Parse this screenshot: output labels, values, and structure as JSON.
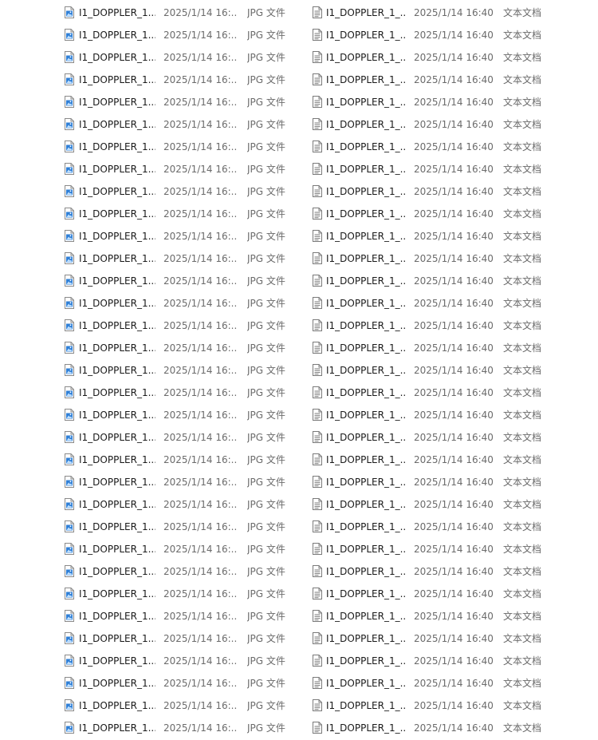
{
  "left_files": [
    {
      "name": "I1_DOPPLER_1...",
      "modified": "2025/1/14 16:...",
      "type": "JPG 文件"
    },
    {
      "name": "I1_DOPPLER_1...",
      "modified": "2025/1/14 16:...",
      "type": "JPG 文件"
    },
    {
      "name": "I1_DOPPLER_1...",
      "modified": "2025/1/14 16:...",
      "type": "JPG 文件"
    },
    {
      "name": "I1_DOPPLER_1...",
      "modified": "2025/1/14 16:...",
      "type": "JPG 文件"
    },
    {
      "name": "I1_DOPPLER_1...",
      "modified": "2025/1/14 16:...",
      "type": "JPG 文件"
    },
    {
      "name": "I1_DOPPLER_1...",
      "modified": "2025/1/14 16:...",
      "type": "JPG 文件"
    },
    {
      "name": "I1_DOPPLER_1...",
      "modified": "2025/1/14 16:...",
      "type": "JPG 文件"
    },
    {
      "name": "I1_DOPPLER_1...",
      "modified": "2025/1/14 16:...",
      "type": "JPG 文件"
    },
    {
      "name": "I1_DOPPLER_1...",
      "modified": "2025/1/14 16:...",
      "type": "JPG 文件"
    },
    {
      "name": "I1_DOPPLER_1...",
      "modified": "2025/1/14 16:...",
      "type": "JPG 文件"
    },
    {
      "name": "I1_DOPPLER_1...",
      "modified": "2025/1/14 16:...",
      "type": "JPG 文件"
    },
    {
      "name": "I1_DOPPLER_1...",
      "modified": "2025/1/14 16:...",
      "type": "JPG 文件"
    },
    {
      "name": "I1_DOPPLER_1...",
      "modified": "2025/1/14 16:...",
      "type": "JPG 文件"
    },
    {
      "name": "I1_DOPPLER_1...",
      "modified": "2025/1/14 16:...",
      "type": "JPG 文件"
    },
    {
      "name": "I1_DOPPLER_1...",
      "modified": "2025/1/14 16:...",
      "type": "JPG 文件"
    },
    {
      "name": "I1_DOPPLER_1...",
      "modified": "2025/1/14 16:...",
      "type": "JPG 文件"
    },
    {
      "name": "I1_DOPPLER_1...",
      "modified": "2025/1/14 16:...",
      "type": "JPG 文件"
    },
    {
      "name": "I1_DOPPLER_1...",
      "modified": "2025/1/14 16:...",
      "type": "JPG 文件"
    },
    {
      "name": "I1_DOPPLER_1...",
      "modified": "2025/1/14 16:...",
      "type": "JPG 文件"
    },
    {
      "name": "I1_DOPPLER_1...",
      "modified": "2025/1/14 16:...",
      "type": "JPG 文件"
    },
    {
      "name": "I1_DOPPLER_1...",
      "modified": "2025/1/14 16:...",
      "type": "JPG 文件"
    },
    {
      "name": "I1_DOPPLER_1...",
      "modified": "2025/1/14 16:...",
      "type": "JPG 文件"
    },
    {
      "name": "I1_DOPPLER_1...",
      "modified": "2025/1/14 16:...",
      "type": "JPG 文件"
    },
    {
      "name": "I1_DOPPLER_1...",
      "modified": "2025/1/14 16:...",
      "type": "JPG 文件"
    },
    {
      "name": "I1_DOPPLER_1...",
      "modified": "2025/1/14 16:...",
      "type": "JPG 文件"
    },
    {
      "name": "I1_DOPPLER_1...",
      "modified": "2025/1/14 16:...",
      "type": "JPG 文件"
    },
    {
      "name": "I1_DOPPLER_1...",
      "modified": "2025/1/14 16:...",
      "type": "JPG 文件"
    },
    {
      "name": "I1_DOPPLER_1...",
      "modified": "2025/1/14 16:...",
      "type": "JPG 文件"
    },
    {
      "name": "I1_DOPPLER_1...",
      "modified": "2025/1/14 16:...",
      "type": "JPG 文件"
    },
    {
      "name": "I1_DOPPLER_1...",
      "modified": "2025/1/14 16:...",
      "type": "JPG 文件"
    },
    {
      "name": "I1_DOPPLER_1...",
      "modified": "2025/1/14 16:...",
      "type": "JPG 文件"
    },
    {
      "name": "I1_DOPPLER_1...",
      "modified": "2025/1/14 16:...",
      "type": "JPG 文件"
    },
    {
      "name": "I1_DOPPLER_1...",
      "modified": "2025/1/14 16:...",
      "type": "JPG 文件"
    }
  ],
  "right_files": [
    {
      "name": "I1_DOPPLER_1_...",
      "modified": "2025/1/14 16:40",
      "type": "文本文档"
    },
    {
      "name": "I1_DOPPLER_1_...",
      "modified": "2025/1/14 16:40",
      "type": "文本文档"
    },
    {
      "name": "I1_DOPPLER_1_...",
      "modified": "2025/1/14 16:40",
      "type": "文本文档"
    },
    {
      "name": "I1_DOPPLER_1_...",
      "modified": "2025/1/14 16:40",
      "type": "文本文档"
    },
    {
      "name": "I1_DOPPLER_1_...",
      "modified": "2025/1/14 16:40",
      "type": "文本文档"
    },
    {
      "name": "I1_DOPPLER_1_...",
      "modified": "2025/1/14 16:40",
      "type": "文本文档"
    },
    {
      "name": "I1_DOPPLER_1_...",
      "modified": "2025/1/14 16:40",
      "type": "文本文档"
    },
    {
      "name": "I1_DOPPLER_1_...",
      "modified": "2025/1/14 16:40",
      "type": "文本文档"
    },
    {
      "name": "I1_DOPPLER_1_...",
      "modified": "2025/1/14 16:40",
      "type": "文本文档"
    },
    {
      "name": "I1_DOPPLER_1_...",
      "modified": "2025/1/14 16:40",
      "type": "文本文档"
    },
    {
      "name": "I1_DOPPLER_1_...",
      "modified": "2025/1/14 16:40",
      "type": "文本文档"
    },
    {
      "name": "I1_DOPPLER_1_...",
      "modified": "2025/1/14 16:40",
      "type": "文本文档"
    },
    {
      "name": "I1_DOPPLER_1_...",
      "modified": "2025/1/14 16:40",
      "type": "文本文档"
    },
    {
      "name": "I1_DOPPLER_1_...",
      "modified": "2025/1/14 16:40",
      "type": "文本文档"
    },
    {
      "name": "I1_DOPPLER_1_...",
      "modified": "2025/1/14 16:40",
      "type": "文本文档"
    },
    {
      "name": "I1_DOPPLER_1_...",
      "modified": "2025/1/14 16:40",
      "type": "文本文档"
    },
    {
      "name": "I1_DOPPLER_1_...",
      "modified": "2025/1/14 16:40",
      "type": "文本文档"
    },
    {
      "name": "I1_DOPPLER_1_...",
      "modified": "2025/1/14 16:40",
      "type": "文本文档"
    },
    {
      "name": "I1_DOPPLER_1_...",
      "modified": "2025/1/14 16:40",
      "type": "文本文档"
    },
    {
      "name": "I1_DOPPLER_1_...",
      "modified": "2025/1/14 16:40",
      "type": "文本文档"
    },
    {
      "name": "I1_DOPPLER_1_...",
      "modified": "2025/1/14 16:40",
      "type": "文本文档"
    },
    {
      "name": "I1_DOPPLER_1_...",
      "modified": "2025/1/14 16:40",
      "type": "文本文档"
    },
    {
      "name": "I1_DOPPLER_1_...",
      "modified": "2025/1/14 16:40",
      "type": "文本文档"
    },
    {
      "name": "I1_DOPPLER_1_...",
      "modified": "2025/1/14 16:40",
      "type": "文本文档"
    },
    {
      "name": "I1_DOPPLER_1_...",
      "modified": "2025/1/14 16:40",
      "type": "文本文档"
    },
    {
      "name": "I1_DOPPLER_1_...",
      "modified": "2025/1/14 16:40",
      "type": "文本文档"
    },
    {
      "name": "I1_DOPPLER_1_...",
      "modified": "2025/1/14 16:40",
      "type": "文本文档"
    },
    {
      "name": "I1_DOPPLER_1_...",
      "modified": "2025/1/14 16:40",
      "type": "文本文档"
    },
    {
      "name": "I1_DOPPLER_1_...",
      "modified": "2025/1/14 16:40",
      "type": "文本文档"
    },
    {
      "name": "I1_DOPPLER_1_...",
      "modified": "2025/1/14 16:40",
      "type": "文本文档"
    },
    {
      "name": "I1_DOPPLER_1_...",
      "modified": "2025/1/14 16:40",
      "type": "文本文档"
    },
    {
      "name": "I1_DOPPLER_1_...",
      "modified": "2025/1/14 16:40",
      "type": "文本文档"
    },
    {
      "name": "I1_DOPPLER_1_...",
      "modified": "2025/1/14 16:40",
      "type": "文本文档"
    }
  ],
  "icons": {
    "left": "jpg-image-file-icon",
    "right": "text-document-file-icon"
  },
  "colors": {
    "image_icon_accent": "#2f7fd6",
    "text_icon_line": "#7a7a7a",
    "secondary_text": "#6b6b6b"
  }
}
